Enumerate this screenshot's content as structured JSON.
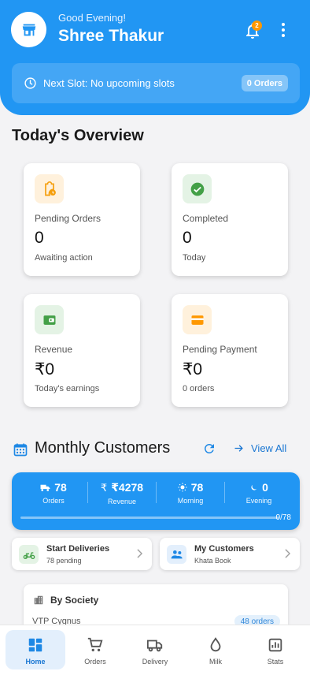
{
  "header": {
    "greeting": "Good Evening!",
    "user_name": "Shree Thakur",
    "notification_count": "2",
    "slot_text": "Next Slot: No upcoming slots",
    "slot_orders": "0 Orders",
    "avatar_icon": "store-icon",
    "bg_color": "#2196f3"
  },
  "overview": {
    "title": "Today's Overview",
    "cards": [
      {
        "label": "Pending Orders",
        "value": "0",
        "sub": "Awaiting action",
        "icon": "clipboard-clock-icon",
        "icon_color": "#f59e0b",
        "icon_bg": "#fff1dc"
      },
      {
        "label": "Completed",
        "value": "0",
        "sub": "Today",
        "icon": "check-circle-icon",
        "icon_color": "#43a047",
        "icon_bg": "#e4f3e5"
      },
      {
        "label": "Revenue",
        "value": "₹0",
        "sub": "Today's earnings",
        "icon": "wallet-icon",
        "icon_color": "#43a047",
        "icon_bg": "#e4f3e5"
      },
      {
        "label": "Pending Payment",
        "value": "₹0",
        "sub": "0 orders",
        "icon": "credit-card-icon",
        "icon_color": "#ff9800",
        "icon_bg": "#fff1dc"
      }
    ]
  },
  "monthly": {
    "title": "Monthly Customers",
    "view_all": "View All",
    "stats": [
      {
        "value": "78",
        "caption": "Orders",
        "icon": "truck-icon"
      },
      {
        "value": "₹4278",
        "caption": "Revenue",
        "icon": "rupee-icon"
      },
      {
        "value": "78",
        "caption": "Morning",
        "icon": "sun-icon"
      },
      {
        "value": "0",
        "caption": "Evening",
        "icon": "moon-icon"
      }
    ],
    "progress_text": "0/78",
    "progress_fraction": 0
  },
  "quick_actions": [
    {
      "title": "Start Deliveries",
      "subtitle": "78 pending",
      "icon": "scooter-icon"
    },
    {
      "title": "My Customers",
      "subtitle": "Khata Book",
      "icon": "people-icon"
    }
  ],
  "society": {
    "title": "By Society",
    "first_name": "VTP Cygnus",
    "first_orders": "48 orders"
  },
  "nav": [
    {
      "label": "Home",
      "icon": "grid-icon",
      "active": true
    },
    {
      "label": "Orders",
      "icon": "cart-icon",
      "active": false
    },
    {
      "label": "Delivery",
      "icon": "truck-icon",
      "active": false
    },
    {
      "label": "Milk",
      "icon": "drop-icon",
      "active": false
    },
    {
      "label": "Stats",
      "icon": "chart-icon",
      "active": false
    }
  ]
}
